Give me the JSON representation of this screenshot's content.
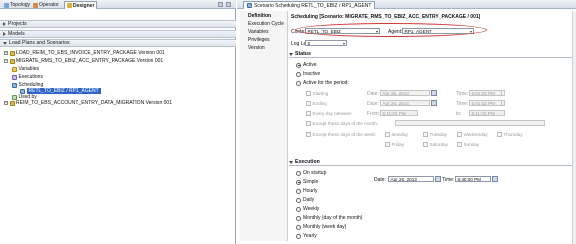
{
  "left_tabs": [
    {
      "label": "Topology"
    },
    {
      "label": "Operator"
    },
    {
      "label": "Designer"
    }
  ],
  "accordions": {
    "projects": "Projects",
    "models": "Models",
    "load_plans": "Load Plans and Scenarios"
  },
  "tree": {
    "item1": "LOAD_REIM_TO_EBS_INVOICE_ENTRY_PACKAGE Version 001",
    "item2": "MIGRATE_RMS_TO_EBIZ_ACC_ENTRY_PACKAGE Version 001",
    "variables": "Variables",
    "executions": "Executions",
    "scheduling": "Scheduling",
    "selected": "RETL_TO_EBIZ / RP1_AGENT",
    "used_by": "Used by",
    "item3": "REIM_TO_EBS_ACCOUNT_ENTRY_DATA_MIGRATION Version 001"
  },
  "right_tab": {
    "label": "Scenario Scheduling RETL_TO_EBIZ / RP1_AGENT"
  },
  "nav": {
    "definition": "Definition",
    "execution_cycle": "Execution Cycle",
    "variables": "Variables",
    "privileges": "Privileges",
    "version": "Version"
  },
  "title": "Scheduling [Scenario: MIGRATE_RMS_TO_EBIZ_ACC_ENTRY_PACKAGE / 001]",
  "form": {
    "context_label": "Context:",
    "context_value": "RETL_TO_EBIZ",
    "agent_label": "Agent:",
    "agent_value": "RP1_AGENT",
    "loglevel_label": "Log Level:",
    "loglevel_value": "5"
  },
  "status": {
    "header": "Status",
    "active": "Active",
    "inactive": "Inactive",
    "period": "Active for the period:",
    "starting": "Starting",
    "ending": "Ending",
    "every_day": "Every day between",
    "date_label": "Date:",
    "time_label": "Time:",
    "from_label": "From:",
    "to_label": "to:",
    "start_date": "Apr 26, 2013",
    "start_time": "6:01:02 PM",
    "end_date": "Apr 26, 2013",
    "end_time": "6:01:02 PM",
    "from_time": "6:11:02 PM",
    "to_time": "6:11:02 PM",
    "except_month": "Except these days of the month:",
    "except_week": "Except these days of the week:",
    "days": [
      "Monday",
      "Tuesday",
      "Wednesday",
      "Thursday",
      "Friday",
      "Saturday",
      "Sunday"
    ]
  },
  "execution": {
    "header": "Execution",
    "options": [
      "On startup",
      "Simple",
      "Hourly",
      "Daily",
      "Weekly",
      "Monthly (day of the month)",
      "Monthly (week day)",
      "Yearly"
    ],
    "date_label": "Date:",
    "date_value": "Apr 26, 2013",
    "time_label": "Time:",
    "time_value": "6:40:00 PM"
  },
  "colors": {
    "selection": "#2f64c8",
    "highlight_oval": "#d23a3a"
  }
}
